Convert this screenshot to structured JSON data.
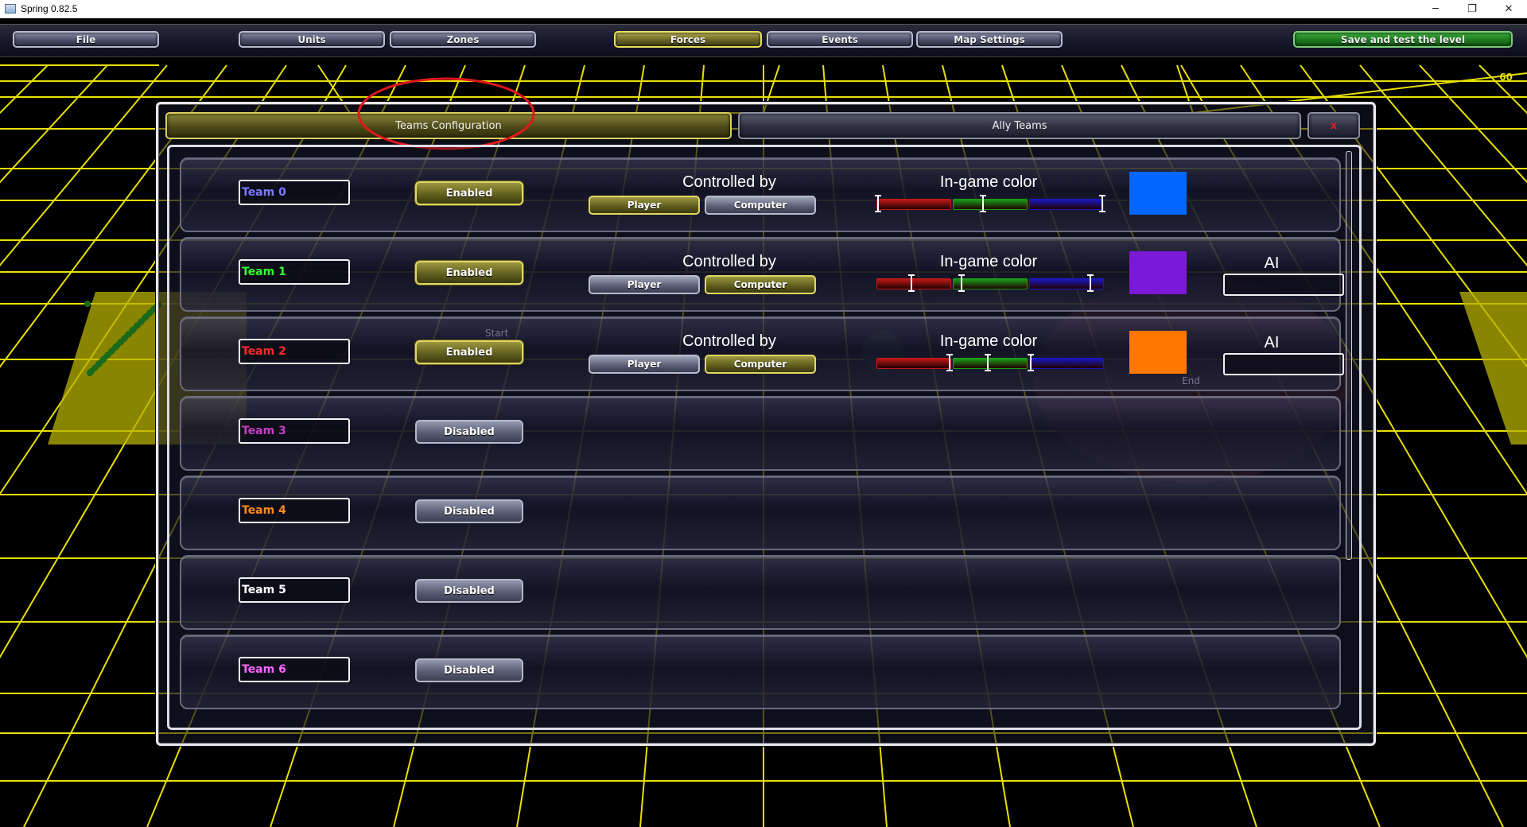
{
  "window": {
    "title": "Spring 0.82.5",
    "minimize": "─",
    "restore": "❐",
    "close": "✕"
  },
  "menu": {
    "items": [
      "File",
      "Units",
      "Zones",
      "Forces",
      "Events",
      "Map Settings"
    ],
    "active": "Forces",
    "save": "Save and test the level"
  },
  "fps": "60",
  "dialog": {
    "tabs": {
      "teams": "Teams Configuration",
      "ally": "Ally Teams",
      "close": "x"
    },
    "labels": {
      "controlled_by": "Controlled by",
      "ingame_color": "In-game color",
      "ai": "AI",
      "player": "Player",
      "computer": "Computer"
    },
    "teams": [
      {
        "name": "Team 0",
        "name_color": "#7b7bff",
        "status": "Enabled",
        "controller": "Player",
        "color": "#0066ff",
        "rgb": [
          0.0,
          0.4,
          1.0
        ],
        "ai": ""
      },
      {
        "name": "Team 1",
        "name_color": "#33ff33",
        "status": "Enabled",
        "controller": "Computer",
        "color": "#7a1ad6",
        "rgb": [
          0.47,
          0.1,
          0.83
        ],
        "ai": ""
      },
      {
        "name": "Team 2",
        "name_color": "#ff2a2a",
        "status": "Enabled",
        "controller": "Computer",
        "color": "#ff7700",
        "rgb": [
          1.0,
          0.47,
          0.0
        ],
        "ai": ""
      },
      {
        "name": "Team 3",
        "name_color": "#c040c0",
        "status": "Disabled"
      },
      {
        "name": "Team 4",
        "name_color": "#ff8a1e",
        "status": "Disabled"
      },
      {
        "name": "Team 5",
        "name_color": "#ffffff",
        "status": "Disabled"
      },
      {
        "name": "Team 6",
        "name_color": "#ff66ff",
        "status": "Disabled"
      }
    ]
  },
  "map_markers": {
    "start": "Start",
    "end": "End"
  },
  "colors": {
    "grid": "#e8e000",
    "accent": "#e0d860",
    "save_green": "#2a9a2a"
  }
}
